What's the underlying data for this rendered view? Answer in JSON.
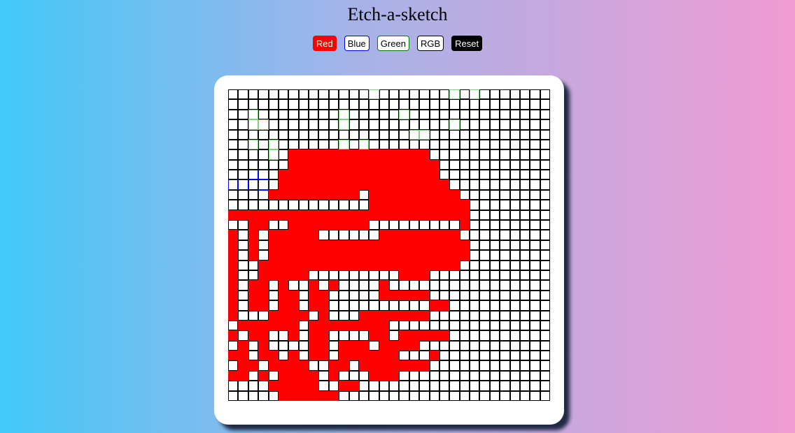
{
  "title": "Etch-a-sketch",
  "buttons": {
    "red": "Red",
    "blue": "Blue",
    "green": "Green",
    "rgb": "RGB",
    "reset": "Reset"
  },
  "colors": {
    "red": "#ff0000",
    "blue": "#0000ff",
    "green": "#008000",
    "black": "#000000"
  },
  "grid": {
    "columns": 32,
    "rows": 31,
    "cells": [
      "..............g.......g.g.......",
      "................................",
      "..g........g.....g..............",
      "..gg.......g..........g.........",
      "..................gg............",
      "..g.g......g.g..................",
      "....g.RRRRRRRRRRRRRR............",
      "......RRRRRRRRRRRRRRR...........",
      "..bb.RRRRRRRRRRRRRRRR...........",
      "bb.b.RRRRRRRRRRRRRRRRR..........",
      "...bRRRRRRRRR.RRRRRRRRR.........",
      "..............RRRRRRRRRR........",
      "RRRRRRRRRRRRRRRRRRRRRRRR........",
      "..RR..RRRRRRRR.........R........",
      "R.R.RRRRR......RRRRRRRR.........",
      "R.R.RRRRRRRRRRRRRRRRRRRR........",
      "R.R.RRRRRRRRRRRRRRRRRRRR........",
      "R..RRRRRRRRRRRRRRRRRRRR.........",
      "R..RRRRR.........RRR............",
      "R.RR.R..R.R....R................",
      "R.RR.RR.RR.....RRRRR............",
      "R.RR.RR.RR..........RR..........",
      "R...RRRR.R...RRRRRRR............",
      ".RRRRRR.RRRRRRRR................",
      "R.RR..R.RR....RR.RRRRR..........",
      ".R.R....RR.RRR.RRRR.............",
      "RR.RR.R.RR.RRRRRR...R...........",
      ".RR.RRRR..RR.RRRRRRR............",
      "RR.R.RRRR.R...RRR...............",
      "....RRRRR..RR...................",
      ".....RRRRRR....................."
    ]
  }
}
